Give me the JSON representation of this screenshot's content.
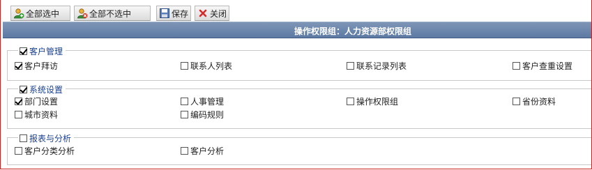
{
  "toolbar": {
    "select_all": "全部选中",
    "deselect_all": "全部不选中",
    "save": "保存",
    "close": "关闭"
  },
  "title": "操作权限组：人力资源部权限组",
  "groups": [
    {
      "label": "客户管理",
      "checked": true,
      "items": [
        {
          "label": "客户拜访",
          "checked": true
        },
        {
          "label": "联系人列表",
          "checked": false
        },
        {
          "label": "联系记录列表",
          "checked": false
        },
        {
          "label": "客户查重设置",
          "checked": false
        }
      ]
    },
    {
      "label": "系统设置",
      "checked": true,
      "items": [
        {
          "label": "部门设置",
          "checked": true
        },
        {
          "label": "人事管理",
          "checked": false
        },
        {
          "label": "操作权限组",
          "checked": false
        },
        {
          "label": "省份资料",
          "checked": false
        },
        {
          "label": "城市资料",
          "checked": false
        },
        {
          "label": "编码规则",
          "checked": false
        }
      ]
    },
    {
      "label": "报表与分析",
      "checked": false,
      "items": [
        {
          "label": "客户分类分析",
          "checked": false
        },
        {
          "label": "客户分析",
          "checked": false
        }
      ]
    }
  ],
  "colors": {
    "titlebar": "#6b86ad",
    "legend_text": "#1a3f8f",
    "frame_border": "#cc2222"
  }
}
